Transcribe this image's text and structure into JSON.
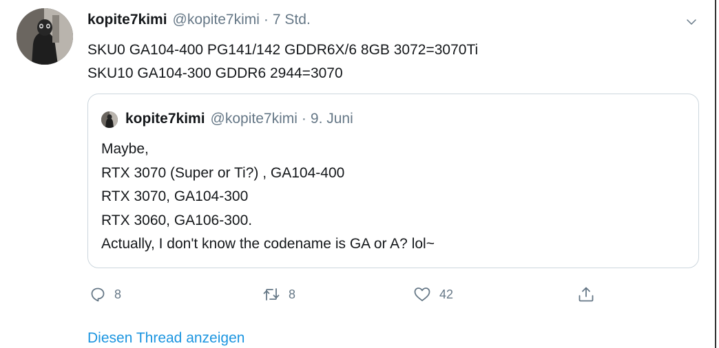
{
  "tweet": {
    "name": "kopite7kimi",
    "handle": "@kopite7kimi",
    "separator": "·",
    "time": "7 Std.",
    "text_lines": [
      "SKU0 GA104-400 PG141/142 GDDR6X/6 8GB 3072=3070Ti",
      "SKU10 GA104-300 GDDR6 2944=3070"
    ],
    "menu_icon": "chevron-down-icon"
  },
  "quote": {
    "name": "kopite7kimi",
    "handle": "@kopite7kimi",
    "separator": "·",
    "time": "9. Juni",
    "text_lines": [
      "Maybe,",
      "RTX 3070 (Super or Ti?) , GA104-400",
      "RTX 3070, GA104-300",
      "RTX 3060, GA106-300.",
      "Actually, I don't know the codename is GA or A? lol~"
    ]
  },
  "actions": {
    "reply": {
      "icon": "reply-icon",
      "count": "8"
    },
    "retweet": {
      "icon": "retweet-icon",
      "count": "8"
    },
    "like": {
      "icon": "heart-icon",
      "count": "42"
    },
    "share": {
      "icon": "share-icon"
    }
  },
  "show_thread": "Diesen Thread anzeigen",
  "colors": {
    "text": "#14171a",
    "secondary": "#657786",
    "link": "#1b95e0",
    "border": "#ccd6dd"
  }
}
